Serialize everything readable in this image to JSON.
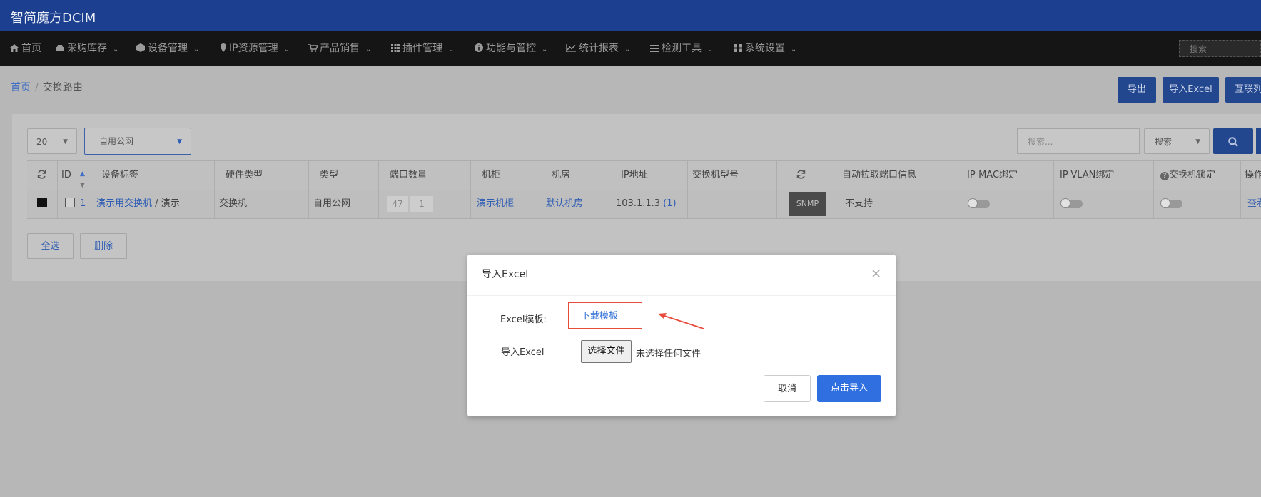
{
  "app": {
    "title": "智简魔方DCIM"
  },
  "nav": {
    "items": [
      {
        "label": "首页",
        "icon": "home-icon"
      },
      {
        "label": "采购库存",
        "icon": "inbox-icon"
      },
      {
        "label": "设备管理",
        "icon": "cube-icon"
      },
      {
        "label": "IP资源管理",
        "icon": "map-marker-icon"
      },
      {
        "label": "产品销售",
        "icon": "cart-icon"
      },
      {
        "label": "插件管理",
        "icon": "grid-icon"
      },
      {
        "label": "功能与管控",
        "icon": "info-icon"
      },
      {
        "label": "统计报表",
        "icon": "chart-icon"
      },
      {
        "label": "检测工具",
        "icon": "list-icon"
      },
      {
        "label": "系统设置",
        "icon": "th-large-icon"
      }
    ],
    "search_placeholder": "搜索"
  },
  "breadcrumb": {
    "home": "首页",
    "current": "交换路由"
  },
  "actions": {
    "export": "导出",
    "import_excel": "导入Excel",
    "internet": "互联列"
  },
  "filters": {
    "page_size": "20",
    "type": "自用公网",
    "search_placeholder": "搜索...",
    "search_field": "搜索"
  },
  "table": {
    "headers": [
      "ID",
      "设备标签",
      "硬件类型",
      "类型",
      "端口数量",
      "机柜",
      "机房",
      "IP地址",
      "交换机型号",
      "自动拉取端口信息",
      "IP-MAC绑定",
      "IP-VLAN绑定",
      "交换机锁定",
      "操作"
    ],
    "rows": [
      {
        "id": "1",
        "label_link": "演示用交换机",
        "label_sep": "/",
        "label_extra": "演示",
        "hardware": "交换机",
        "type": "自用公网",
        "port_a": "47",
        "port_b": "1",
        "cabinet": "演示机柜",
        "room": "默认机房",
        "ip": "103.1.1.3",
        "ip_count": "(1)",
        "model": "",
        "snmp": "SNMP",
        "auto_pull": "不支持",
        "ip_mac": false,
        "ip_vlan": false,
        "switch_lock": false,
        "action": "查看"
      }
    ]
  },
  "bulk": {
    "select_all": "全选",
    "delete": "删除"
  },
  "modal": {
    "title": "导入Excel",
    "template_label": "Excel模板:",
    "template_link": "下载模板",
    "file_label": "导入Excel",
    "file_button": "选择文件",
    "file_status": "未选择任何文件",
    "cancel": "取消",
    "submit": "点击导入"
  },
  "colors": {
    "header_bg": "#1c3f8f",
    "nav_bg": "#151515",
    "primary": "#2f6fe0",
    "highlight_red": "#e74c3c"
  }
}
